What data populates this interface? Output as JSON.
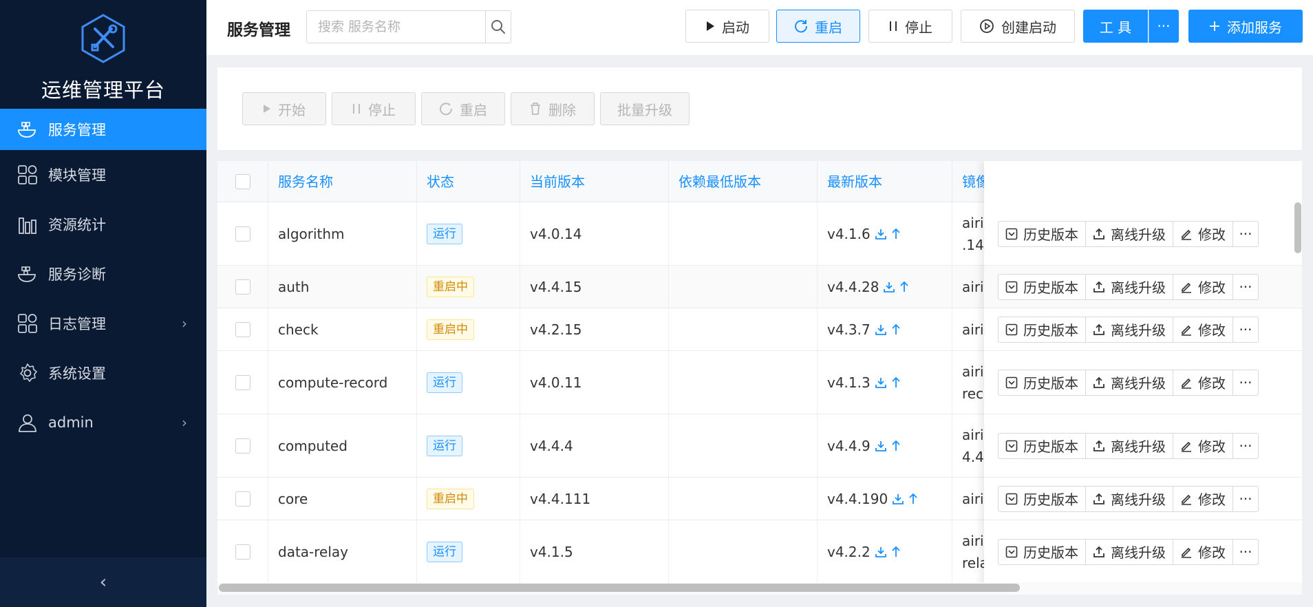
{
  "sidebar": {
    "brand": "运维管理平台",
    "items": [
      {
        "label": "服务管理",
        "icon": "docker-icon",
        "active": true
      },
      {
        "label": "模块管理",
        "icon": "grid-icon"
      },
      {
        "label": "资源统计",
        "icon": "bar-chart-icon"
      },
      {
        "label": "服务诊断",
        "icon": "docker-icon"
      },
      {
        "label": "日志管理",
        "icon": "grid-icon",
        "expandable": true
      },
      {
        "label": "系统设置",
        "icon": "gear-icon"
      },
      {
        "label": "admin",
        "icon": "user-icon",
        "expandable": true
      }
    ],
    "collapse_glyph": "‹"
  },
  "header": {
    "title": "服务管理",
    "search_placeholder": "搜索 服务名称",
    "buttons": {
      "start": "启动",
      "restart": "重启",
      "stop": "停止",
      "create_start": "创建启动",
      "tools": "工 具",
      "tools_more": "···",
      "add_service": "添加服务"
    }
  },
  "batch": {
    "start": "开始",
    "stop": "停止",
    "restart": "重启",
    "delete": "删除",
    "upgrade": "批量升级"
  },
  "table": {
    "columns": [
      "服务名称",
      "状态",
      "当前版本",
      "依赖最低版本",
      "最新版本",
      "镜像"
    ],
    "actions": {
      "history": "历史版本",
      "offline_upgrade": "离线升级",
      "edit": "修改",
      "more": "···"
    },
    "rows": [
      {
        "name": "algorithm",
        "status": "运行",
        "status_type": "run",
        "current": "v4.0.14",
        "min_dep": "",
        "latest": "v4.1.6",
        "image_l1": "airic",
        "image_l2": ".14"
      },
      {
        "name": "auth",
        "status": "重启中",
        "status_type": "restart",
        "current": "v4.4.15",
        "min_dep": "",
        "latest": "v4.4.28",
        "image_l1": "airic",
        "image_l2": ""
      },
      {
        "name": "check",
        "status": "重启中",
        "status_type": "restart",
        "current": "v4.2.15",
        "min_dep": "",
        "latest": "v4.3.7",
        "image_l1": "airic",
        "image_l2": ""
      },
      {
        "name": "compute-record",
        "status": "运行",
        "status_type": "run",
        "current": "v4.0.11",
        "min_dep": "",
        "latest": "v4.1.3",
        "image_l1": "airic",
        "image_l2": "reco"
      },
      {
        "name": "computed",
        "status": "运行",
        "status_type": "run",
        "current": "v4.4.4",
        "min_dep": "",
        "latest": "v4.4.9",
        "image_l1": "airic",
        "image_l2": "4.4"
      },
      {
        "name": "core",
        "status": "重启中",
        "status_type": "restart",
        "current": "v4.4.111",
        "min_dep": "",
        "latest": "v4.4.190",
        "image_l1": "airic",
        "image_l2": ""
      },
      {
        "name": "data-relay",
        "status": "运行",
        "status_type": "run",
        "current": "v4.1.5",
        "min_dep": "",
        "latest": "v4.2.2",
        "image_l1": "airic",
        "image_l2": "rela"
      }
    ]
  },
  "colors": {
    "primary": "#1890ff",
    "sidebar": "#0b1a33",
    "warning": "#d48806"
  }
}
